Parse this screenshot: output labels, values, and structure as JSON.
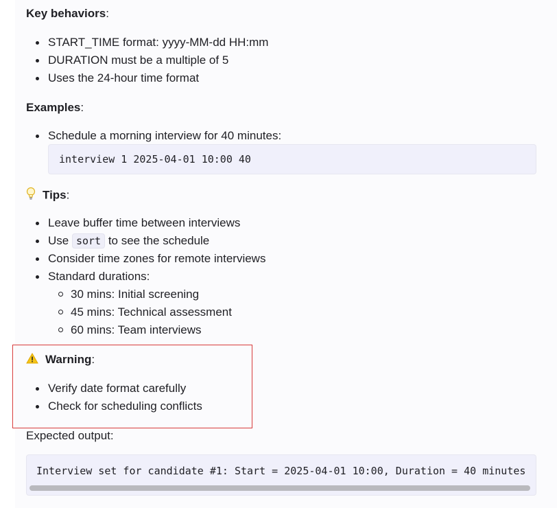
{
  "key_behaviors": {
    "heading": "Key behaviors",
    "colon": ":",
    "items": [
      "START_TIME format: yyyy-MM-dd HH:mm",
      "DURATION must be a multiple of 5",
      "Uses the 24-hour time format"
    ]
  },
  "examples": {
    "heading": "Examples",
    "colon": ":",
    "items": [
      "Schedule a morning interview for 40 minutes:"
    ],
    "code": "interview 1 2025-04-01 10:00 40"
  },
  "tips": {
    "icon": "lightbulb-icon",
    "heading": "Tips",
    "colon": ":",
    "items": [
      "Leave buffer time between interviews",
      "Consider time zones for remote interviews",
      "Standard durations:"
    ],
    "use_prefix": "Use",
    "use_code": "sort",
    "use_suffix": "to see the schedule",
    "durations": [
      "30 mins: Initial screening",
      "45 mins: Technical assessment",
      "60 mins: Team interviews"
    ]
  },
  "warning": {
    "icon": "warning-icon",
    "heading": "Warning",
    "colon": ":",
    "items": [
      "Verify date format carefully",
      "Check for scheduling conflicts"
    ],
    "highlight_color": "#d83a3a"
  },
  "expected": {
    "label": "Expected output:",
    "code": "Interview set for candidate #1: Start = 2025-04-01 10:00, Duration = 40 minutes"
  }
}
